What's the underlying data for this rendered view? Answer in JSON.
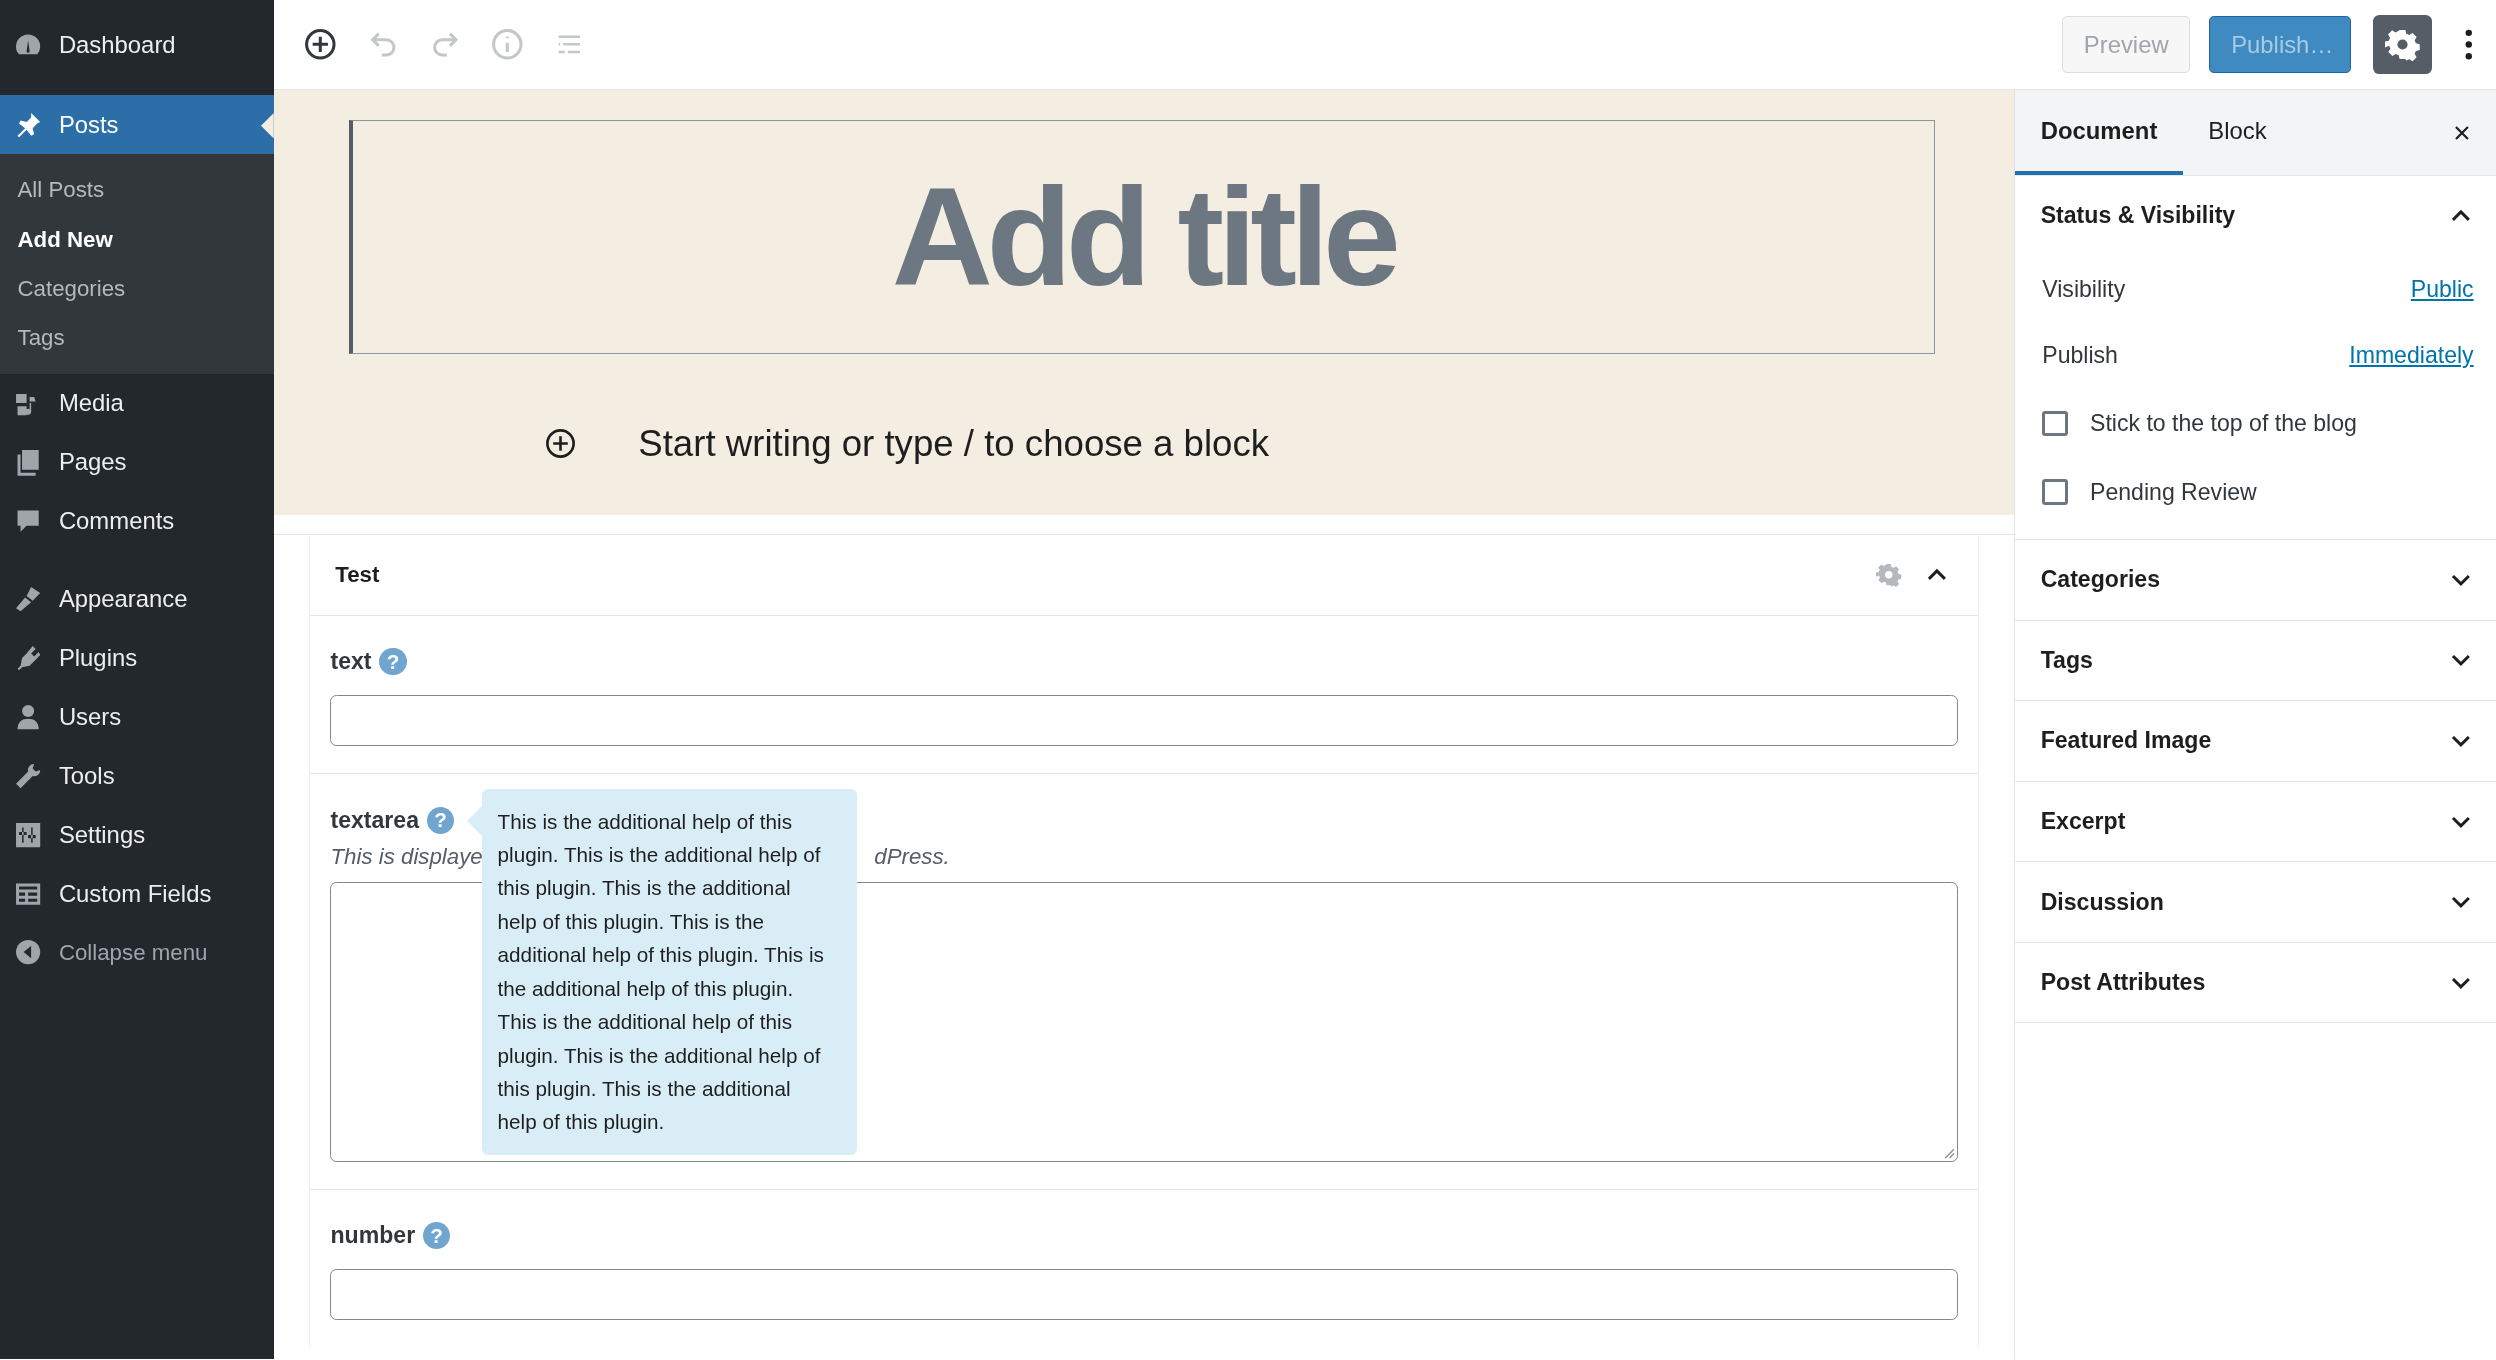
{
  "admin_menu": {
    "items": [
      {
        "label": "Dashboard",
        "selected": false
      },
      {
        "label": "Posts",
        "selected": true,
        "children": [
          {
            "label": "All Posts",
            "selected": false
          },
          {
            "label": "Add New",
            "selected": true
          },
          {
            "label": "Categories",
            "selected": false
          },
          {
            "label": "Tags",
            "selected": false
          }
        ]
      },
      {
        "label": "Media",
        "selected": false
      },
      {
        "label": "Pages",
        "selected": false
      },
      {
        "label": "Comments",
        "selected": false
      },
      {
        "label": "Appearance",
        "selected": false
      },
      {
        "label": "Plugins",
        "selected": false
      },
      {
        "label": "Users",
        "selected": false
      },
      {
        "label": "Tools",
        "selected": false
      },
      {
        "label": "Settings",
        "selected": false
      },
      {
        "label": "Custom Fields",
        "selected": false
      }
    ],
    "collapse_label": "Collapse menu"
  },
  "toolbar": {
    "tools": [
      {
        "kind": "add",
        "disabled": false
      },
      {
        "kind": "undo",
        "disabled": true
      },
      {
        "kind": "redo",
        "disabled": true
      },
      {
        "kind": "info",
        "disabled": true
      },
      {
        "kind": "outline",
        "disabled": true
      }
    ],
    "preview": {
      "label": "Preview",
      "disabled": true
    },
    "publish": {
      "label": "Publish…",
      "disabled": true
    },
    "settings_selected": true
  },
  "editor": {
    "title_placeholder": "Add title",
    "block_placeholder": "Start writing or type / to choose a block"
  },
  "meta_box": {
    "title": "Test",
    "expanded": true,
    "fields": [
      {
        "kind": "text",
        "label": "text",
        "help_mark": "?"
      },
      {
        "kind": "textarea",
        "label": "textarea",
        "help_mark": "?",
        "description_before": "This is displaye",
        "description_after": "dPress.",
        "tooltip": "This is the additional help of this plugin. This is the additional help of this plugin. This is the additional help of this plugin. This is the additional help of this plugin. This is the additional help of this plugin. This is the additional help of this plugin. This is the additional help of this plugin. This is the additional help of this plugin."
      },
      {
        "kind": "number",
        "label": "number",
        "help_mark": "?"
      }
    ]
  },
  "settings_panel": {
    "tabs": [
      {
        "label": "Document",
        "selected": true
      },
      {
        "label": "Block",
        "selected": false
      }
    ],
    "sections": [
      {
        "title": "Status & Visibility",
        "expanded": true,
        "rows": [
          {
            "kind": "link",
            "label": "Visibility",
            "value": "Public"
          },
          {
            "kind": "link",
            "label": "Publish",
            "value": "Immediately"
          },
          {
            "kind": "checkbox",
            "label": "Stick to the top of the blog",
            "checked": false
          },
          {
            "kind": "checkbox",
            "label": "Pending Review",
            "checked": false
          }
        ]
      },
      {
        "title": "Categories",
        "expanded": false
      },
      {
        "title": "Tags",
        "expanded": false
      },
      {
        "title": "Featured Image",
        "expanded": false
      },
      {
        "title": "Excerpt",
        "expanded": false
      },
      {
        "title": "Discussion",
        "expanded": false
      },
      {
        "title": "Post Attributes",
        "expanded": false
      }
    ]
  }
}
